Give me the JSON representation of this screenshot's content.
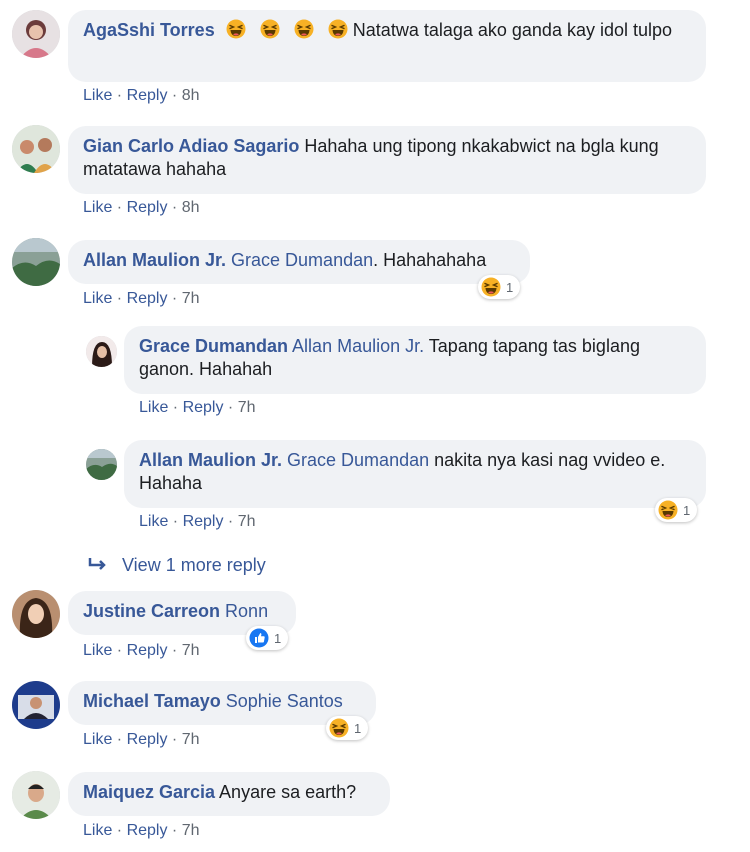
{
  "comments": [
    {
      "author": "AgaSshi Torres",
      "mention": "",
      "text": " Natatwa talaga ako ganda kay idol tulpo",
      "emoji_count": 4,
      "like": "Like",
      "reply": "Reply",
      "time": "8h"
    },
    {
      "author": "Gian Carlo Adiao Sagario",
      "mention": "",
      "text": " Hahaha ung tipong nkakabwict na bgla kung matatawa hahaha",
      "like": "Like",
      "reply": "Reply",
      "time": "8h"
    },
    {
      "author": "Allan Maulion Jr.",
      "mention": " Grace Dumandan",
      "text": ". Hahahahaha",
      "like": "Like",
      "reply": "Reply",
      "time": "7h",
      "reaction": {
        "icon": "haha-icon",
        "count": "1"
      }
    },
    {
      "author": "Grace Dumandan",
      "mention": " Allan Maulion Jr.",
      "text": " Tapang tapang tas biglang ganon. Hahahah",
      "like": "Like",
      "reply": "Reply",
      "time": "7h"
    },
    {
      "author": "Allan Maulion Jr.",
      "mention": " Grace Dumandan",
      "text": " nakita nya kasi nag vvideo e. Hahaha",
      "like": "Like",
      "reply": "Reply",
      "time": "7h",
      "reaction": {
        "icon": "haha-icon",
        "count": "1"
      }
    },
    {
      "author": "Justine Carreon",
      "mention": " Ronn",
      "text": "",
      "like": "Like",
      "reply": "Reply",
      "time": "7h",
      "reaction": {
        "icon": "like-icon",
        "count": "1"
      }
    },
    {
      "author": "Michael Tamayo",
      "mention": " Sophie Santos",
      "text": "",
      "like": "Like",
      "reply": "Reply",
      "time": "7h",
      "reaction": {
        "icon": "haha-icon",
        "count": "1"
      }
    },
    {
      "author": "Maiquez Garcia",
      "mention": "",
      "text": " Anyare sa earth?",
      "like": "Like",
      "reply": "Reply",
      "time": "7h"
    }
  ],
  "view_more": {
    "label": "View 1 more reply",
    "icon": "reply-arrow-icon"
  },
  "colors": {
    "link": "#385898",
    "bubble": "#f0f2f5",
    "meta": "#606770"
  }
}
